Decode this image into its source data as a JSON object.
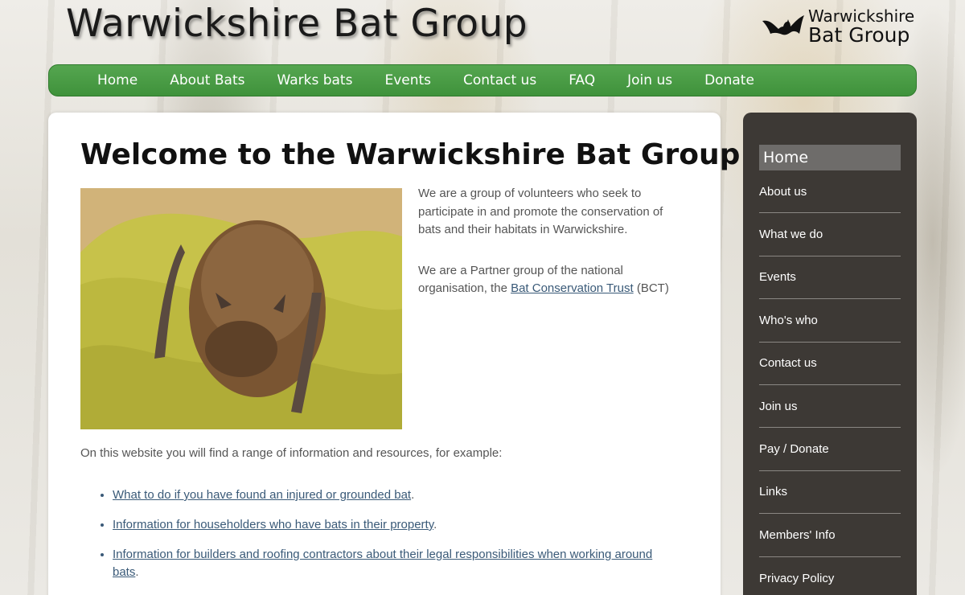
{
  "header": {
    "site_title": "Warwickshire Bat Group",
    "logo_line1": "Warwickshire",
    "logo_line2": "Bat Group"
  },
  "nav": {
    "items": [
      "Home",
      "About Bats",
      "Warks bats",
      "Events",
      "Contact us",
      "FAQ",
      "Join us",
      "Donate"
    ]
  },
  "main": {
    "title": "Welcome to the Warwickshire Bat Group",
    "intro_p1": "We are a group of volunteers who seek to participate in and promote the conservation of bats and their habitats in Warwickshire.",
    "intro_p2_prefix": "We are a Partner group of the national organisation, the ",
    "intro_p2_link": "Bat Conservation Trust",
    "intro_p2_suffix": " (BCT)",
    "find_text": "On this website you will find a range of information and resources, for example:",
    "resources": [
      {
        "link": "What to do if you have found an injured or grounded bat",
        "suffix": "."
      },
      {
        "link": "Information for householders who have bats in their property",
        "suffix": "."
      },
      {
        "link": "Information for builders and roofing contractors about their legal responsibilities when working around bats",
        "suffix": "."
      }
    ]
  },
  "sidebar": {
    "active": "Home",
    "items": [
      "About us",
      "What we do",
      "Events",
      "Who's who",
      "Contact us",
      "Join us",
      "Pay / Donate",
      "Links",
      "Members' Info",
      "Privacy Policy"
    ]
  },
  "colors": {
    "nav_green": "#4a9e46",
    "sidebar_bg": "#3d3935",
    "link": "#3a5a78"
  }
}
